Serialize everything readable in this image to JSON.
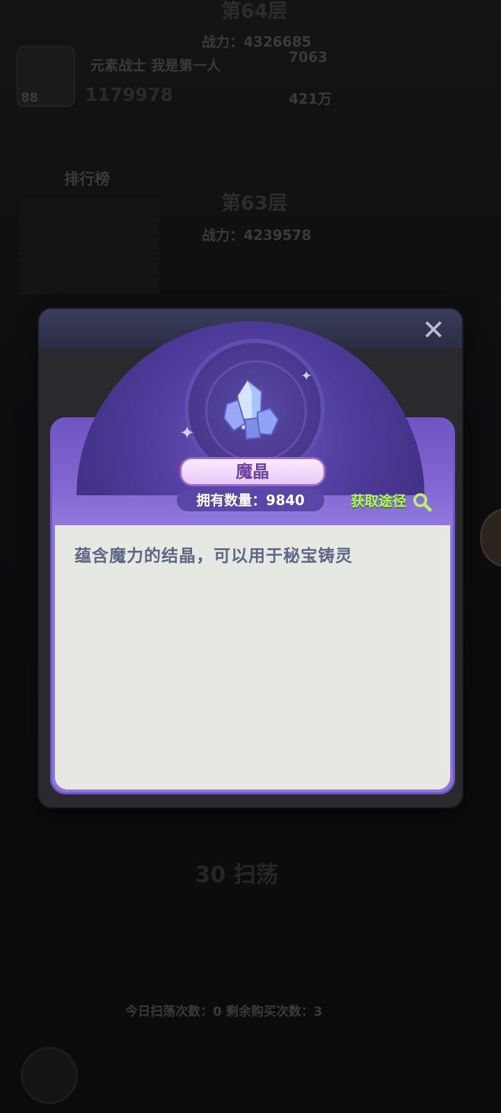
{
  "background": {
    "floor_top": "第64层",
    "power_top": "战力：4326685",
    "player_name": "元素战士 我是第一人",
    "player_power": "1179978",
    "score_1": "7063",
    "score_2": "421万",
    "level": "88",
    "rank_title": "排行榜",
    "floor_mid": "第63层",
    "power_mid": "战力：4239578",
    "sweep": "30 扫荡",
    "bottom_info": "今日扫荡次数：0 剩余购买次数：3"
  },
  "modal": {
    "close_icon": "close-x-icon",
    "item": {
      "name": "魔晶",
      "count_label": "拥有数量：9840",
      "obtain_label": "获取途径",
      "description": "蕴含魔力的结晶，可以用于秘宝铸灵",
      "icon": "crystal-icon"
    }
  },
  "colors": {
    "card_purple": "#8e76d8",
    "card_body": "#e6e8e2",
    "obtain_green": "#b8f06a",
    "desc_text": "#5d6685"
  }
}
